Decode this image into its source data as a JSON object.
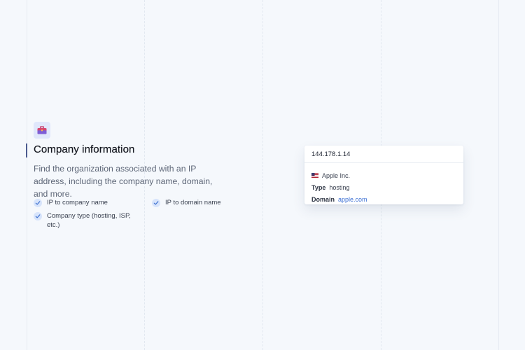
{
  "feature": {
    "icon": "briefcase-icon",
    "title": "Company information",
    "description": "Find the organization associated with an IP address, including the company name, domain, and more.",
    "checklist": [
      {
        "label": "IP to company name"
      },
      {
        "label": "IP to domain name"
      },
      {
        "label": "Company type (hosting, ISP, etc.)"
      }
    ]
  },
  "card": {
    "ip": "144.178.1.14",
    "company_flag": "us-flag-icon",
    "company_name": "Apple Inc.",
    "type_label": "Type",
    "type_value": "hosting",
    "domain_label": "Domain",
    "domain_value": "apple.com"
  },
  "colors": {
    "background": "#f5f8fc",
    "accent": "#4b5a8f",
    "link": "#3b6fd4",
    "check_bg": "#d7e4fb",
    "icon_bg": "#e0e7fb"
  }
}
